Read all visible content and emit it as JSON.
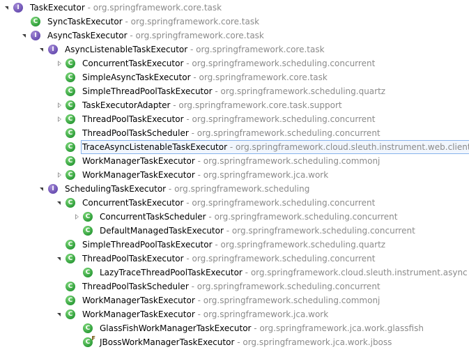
{
  "separator": " - ",
  "rows": [
    {
      "indent": 0,
      "toggle": "expanded",
      "icon": "interface",
      "badge": "",
      "name": "TaskExecutor",
      "pkg": "org.springframework.core.task",
      "selected": false
    },
    {
      "indent": 1,
      "toggle": "none",
      "icon": "class",
      "badge": "",
      "name": "SyncTaskExecutor",
      "pkg": "org.springframework.core.task",
      "selected": false
    },
    {
      "indent": 1,
      "toggle": "expanded",
      "icon": "interface",
      "badge": "",
      "name": "AsyncTaskExecutor",
      "pkg": "org.springframework.core.task",
      "selected": false
    },
    {
      "indent": 2,
      "toggle": "expanded",
      "icon": "interface",
      "badge": "",
      "name": "AsyncListenableTaskExecutor",
      "pkg": "org.springframework.core.task",
      "selected": false
    },
    {
      "indent": 3,
      "toggle": "collapsed",
      "icon": "class",
      "badge": "",
      "name": "ConcurrentTaskExecutor",
      "pkg": "org.springframework.scheduling.concurrent",
      "selected": false
    },
    {
      "indent": 3,
      "toggle": "none",
      "icon": "class",
      "badge": "",
      "name": "SimpleAsyncTaskExecutor",
      "pkg": "org.springframework.core.task",
      "selected": false
    },
    {
      "indent": 3,
      "toggle": "none",
      "icon": "class",
      "badge": "",
      "name": "SimpleThreadPoolTaskExecutor",
      "pkg": "org.springframework.scheduling.quartz",
      "selected": false
    },
    {
      "indent": 3,
      "toggle": "collapsed",
      "icon": "class",
      "badge": "",
      "name": "TaskExecutorAdapter",
      "pkg": "org.springframework.core.task.support",
      "selected": false
    },
    {
      "indent": 3,
      "toggle": "collapsed",
      "icon": "class",
      "badge": "",
      "name": "ThreadPoolTaskExecutor",
      "pkg": "org.springframework.scheduling.concurrent",
      "selected": false
    },
    {
      "indent": 3,
      "toggle": "none",
      "icon": "class",
      "badge": "",
      "name": "ThreadPoolTaskScheduler",
      "pkg": "org.springframework.scheduling.concurrent",
      "selected": false
    },
    {
      "indent": 3,
      "toggle": "none",
      "icon": "class",
      "badge": "",
      "name": "TraceAsyncListenableTaskExecutor",
      "pkg": "org.springframework.cloud.sleuth.instrument.web.client",
      "selected": true
    },
    {
      "indent": 3,
      "toggle": "none",
      "icon": "class",
      "badge": "",
      "name": "WorkManagerTaskExecutor",
      "pkg": "org.springframework.scheduling.commonj",
      "selected": false
    },
    {
      "indent": 3,
      "toggle": "collapsed",
      "icon": "class",
      "badge": "",
      "name": "WorkManagerTaskExecutor",
      "pkg": "org.springframework.jca.work",
      "selected": false
    },
    {
      "indent": 2,
      "toggle": "expanded",
      "icon": "interface",
      "badge": "",
      "name": "SchedulingTaskExecutor",
      "pkg": "org.springframework.scheduling",
      "selected": false
    },
    {
      "indent": 3,
      "toggle": "expanded",
      "icon": "class",
      "badge": "",
      "name": "ConcurrentTaskExecutor",
      "pkg": "org.springframework.scheduling.concurrent",
      "selected": false
    },
    {
      "indent": 4,
      "toggle": "collapsed",
      "icon": "class",
      "badge": "",
      "name": "ConcurrentTaskScheduler",
      "pkg": "org.springframework.scheduling.concurrent",
      "selected": false
    },
    {
      "indent": 4,
      "toggle": "none",
      "icon": "class",
      "badge": "",
      "name": "DefaultManagedTaskExecutor",
      "pkg": "org.springframework.scheduling.concurrent",
      "selected": false
    },
    {
      "indent": 3,
      "toggle": "none",
      "icon": "class",
      "badge": "",
      "name": "SimpleThreadPoolTaskExecutor",
      "pkg": "org.springframework.scheduling.quartz",
      "selected": false
    },
    {
      "indent": 3,
      "toggle": "expanded",
      "icon": "class",
      "badge": "",
      "name": "ThreadPoolTaskExecutor",
      "pkg": "org.springframework.scheduling.concurrent",
      "selected": false
    },
    {
      "indent": 4,
      "toggle": "none",
      "icon": "class",
      "badge": "",
      "name": "LazyTraceThreadPoolTaskExecutor",
      "pkg": "org.springframework.cloud.sleuth.instrument.async",
      "selected": false
    },
    {
      "indent": 3,
      "toggle": "none",
      "icon": "class",
      "badge": "",
      "name": "ThreadPoolTaskScheduler",
      "pkg": "org.springframework.scheduling.concurrent",
      "selected": false
    },
    {
      "indent": 3,
      "toggle": "none",
      "icon": "class",
      "badge": "",
      "name": "WorkManagerTaskExecutor",
      "pkg": "org.springframework.scheduling.commonj",
      "selected": false
    },
    {
      "indent": 3,
      "toggle": "expanded",
      "icon": "class",
      "badge": "",
      "name": "WorkManagerTaskExecutor",
      "pkg": "org.springframework.jca.work",
      "selected": false
    },
    {
      "indent": 4,
      "toggle": "none",
      "icon": "class",
      "badge": "",
      "name": "GlassFishWorkManagerTaskExecutor",
      "pkg": "org.springframework.jca.work.glassfish",
      "selected": false
    },
    {
      "indent": 4,
      "toggle": "none",
      "icon": "class",
      "badge": "F",
      "name": "JBossWorkManagerTaskExecutor",
      "pkg": "org.springframework.jca.work.jboss",
      "selected": false
    }
  ],
  "icon_letters": {
    "class": "C",
    "interface": "I"
  },
  "colors": {
    "class_icon": "#2f9e3a",
    "interface_icon": "#6a4fb2",
    "package_text": "#8a8a8a",
    "selection_border": "#86b2ec",
    "selection_fill": "#f1f6fd"
  }
}
